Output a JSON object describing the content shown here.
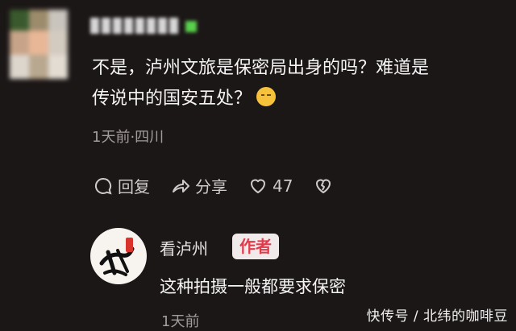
{
  "comment": {
    "text_line1": "不是，泸州文旅是保密局出身的吗？难道是",
    "text_line2": "传说中的国安五处？",
    "meta": "1天前·四川",
    "actions": {
      "reply_label": "回复",
      "share_label": "分享",
      "like_count": "47"
    }
  },
  "reply": {
    "username": "看泸州",
    "badge": "作者",
    "text": "这种拍摄一般都要求保密",
    "meta": "1天前"
  },
  "watermark": "快传号 / 北纬的咖啡豆",
  "colors": {
    "background": "#1c1717",
    "badge_text": "#e23a4a",
    "meta_text": "#a29c9a"
  }
}
